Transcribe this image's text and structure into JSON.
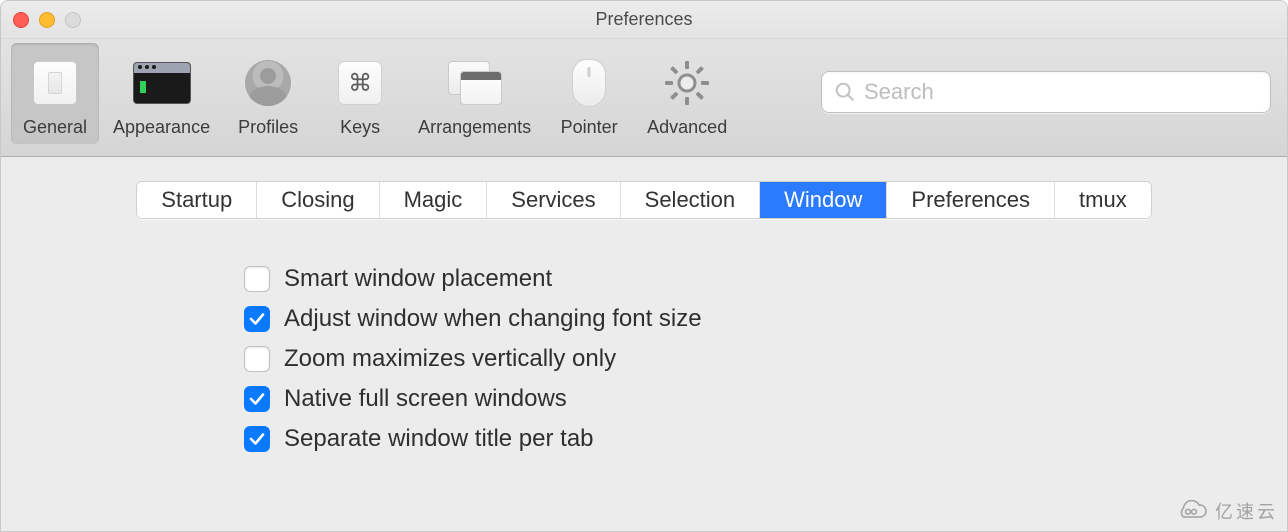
{
  "window": {
    "title": "Preferences"
  },
  "toolbar": {
    "items": [
      {
        "label": "General",
        "selected": true
      },
      {
        "label": "Appearance",
        "selected": false
      },
      {
        "label": "Profiles",
        "selected": false
      },
      {
        "label": "Keys",
        "selected": false
      },
      {
        "label": "Arrangements",
        "selected": false
      },
      {
        "label": "Pointer",
        "selected": false
      },
      {
        "label": "Advanced",
        "selected": false
      }
    ],
    "search": {
      "placeholder": "Search",
      "value": ""
    },
    "keys_glyph": "⌘"
  },
  "subtabs": [
    {
      "label": "Startup",
      "active": false
    },
    {
      "label": "Closing",
      "active": false
    },
    {
      "label": "Magic",
      "active": false
    },
    {
      "label": "Services",
      "active": false
    },
    {
      "label": "Selection",
      "active": false
    },
    {
      "label": "Window",
      "active": true
    },
    {
      "label": "Preferences",
      "active": false
    },
    {
      "label": "tmux",
      "active": false
    }
  ],
  "options": [
    {
      "label": "Smart window placement",
      "checked": false
    },
    {
      "label": "Adjust window when changing font size",
      "checked": true
    },
    {
      "label": "Zoom maximizes vertically only",
      "checked": false
    },
    {
      "label": "Native full screen windows",
      "checked": true
    },
    {
      "label": "Separate window title per tab",
      "checked": true
    }
  ],
  "colors": {
    "accent": "#0a7bff"
  },
  "watermark": {
    "text": "亿速云"
  }
}
